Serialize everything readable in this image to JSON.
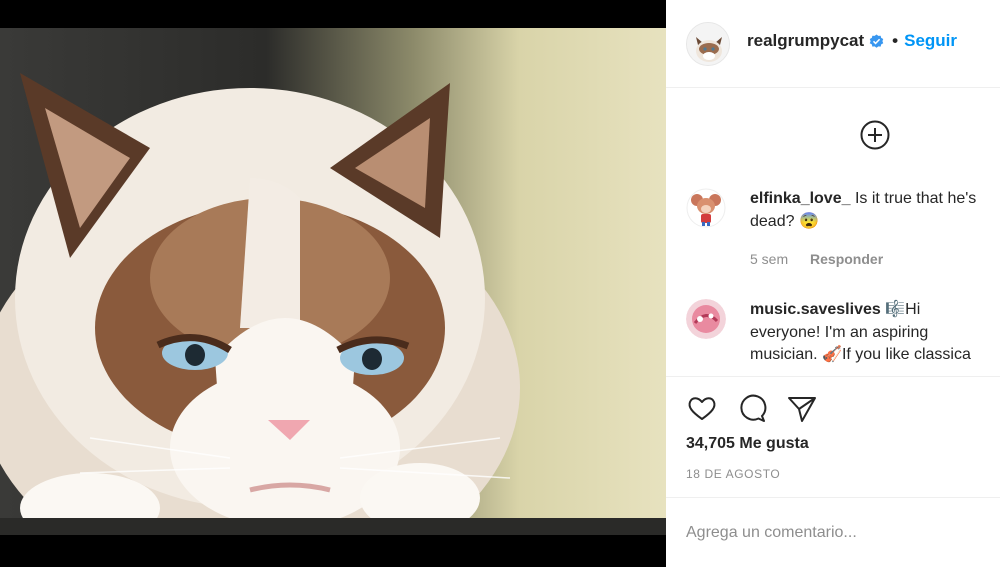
{
  "post": {
    "image_subject": "grumpy-cat-photo"
  },
  "header": {
    "username": "realgrumpycat",
    "verified_icon": "verified-badge-icon",
    "separator": "•",
    "follow_label": "Seguir"
  },
  "add_icon": "plus-circle-icon",
  "comments": [
    {
      "username": "elfinka_love_",
      "line1": "Is it true that he's",
      "line2": "dead? 😨",
      "time": "5 sem",
      "reply_label": "Responder"
    },
    {
      "username": "music.saveslives",
      "line1": "🎼Hi",
      "line2": "everyone! I'm an aspiring",
      "line3": "musician. 🎻If you like classica"
    }
  ],
  "actions": {
    "like_icon": "heart-icon",
    "comment_icon": "comment-bubble-icon",
    "share_icon": "paper-plane-icon",
    "likes_text": "34,705 Me gusta",
    "date_text": "18 DE AGOSTO"
  },
  "composer": {
    "placeholder": "Agrega un comentario..."
  },
  "colors": {
    "link_blue": "#0095f6",
    "muted": "#8e8e8e",
    "border": "#efefef"
  }
}
